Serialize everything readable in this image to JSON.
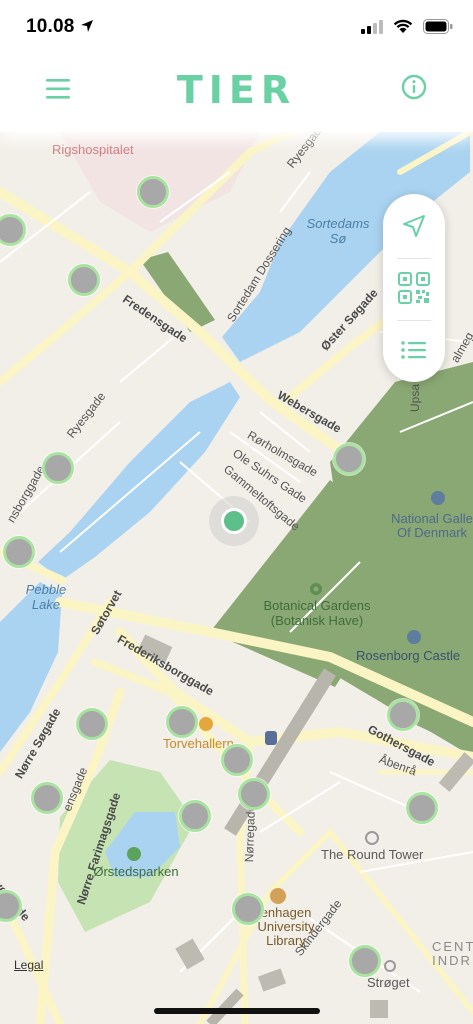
{
  "status_bar": {
    "time": "10.08"
  },
  "header": {
    "brand": "TIER"
  },
  "map": {
    "street_labels": {
      "fredensgade": "Fredensgade",
      "sortedam_dossering": "Sortedam Dossering",
      "oster_sogade": "Øster Søgade",
      "webersgade": "Webersgade",
      "rorholmsgade": "Rørholmsgade",
      "ole_suhrs_gade": "Ole Suhrs Gade",
      "gammeltoftsgade": "Gammeltoftsgade",
      "ryesgade_top": "Ryesgade",
      "ryesgade": "Ryesgade",
      "ansborggade": "nsborggade",
      "sotorvet": "Søtorvet",
      "frederiksborggade": "Frederiksborggade",
      "norre_sogade": "Nørre Søgade",
      "ensgade": "ensgade",
      "norre_farimagsgade": "Nørre Farimagsgade",
      "norregade": "Nørregade",
      "gothersgade": "Gothersgade",
      "abenra": "Åbenrå",
      "skindergade": "Skindergade",
      "vesgade": "vesgade",
      "upsa": "Upsa",
      "almeg": "almeg"
    },
    "water_labels": {
      "sortedams_so": "Sortedams Sø",
      "pebble_lake": "Pebble Lake"
    },
    "park_labels": {
      "botanical": "Botanical Gardens (Botanisk Have)",
      "orstedsparken": "Ørstedsparken"
    },
    "poi_labels": {
      "rigshospitalet": "Rigshospitalet",
      "national_gallery": "National Galle Of Denmark",
      "rosenborg": "Rosenborg Castle",
      "torvehallerne": "Torvehallern",
      "round_tower": "The Round Tower",
      "university_library": "enhagen University Library",
      "stroget": "Strøget",
      "centre": "CENT INDR"
    },
    "legal": "Legal"
  },
  "controls": {
    "locate": "navigation-icon",
    "scan": "qr-code-icon",
    "list": "list-icon"
  },
  "colors": {
    "accent": "#69d1a3",
    "water": "#a9d3f0",
    "park": "#8aa874",
    "road": "#fbf4c5"
  }
}
